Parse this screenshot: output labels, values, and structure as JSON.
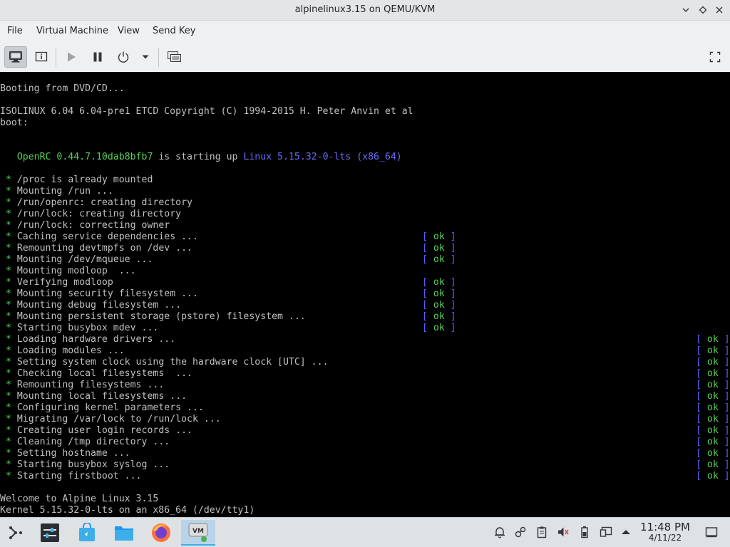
{
  "window": {
    "title": "alpinelinux3.15 on QEMU/KVM"
  },
  "menu": {
    "items": [
      "File",
      "Virtual Machine",
      "View",
      "Send Key"
    ]
  },
  "toolbar": {
    "tools": [
      "console-icon",
      "details-icon",
      "run-icon",
      "pause-icon",
      "power-icon",
      "dropdown-arrow-icon",
      "snapshots-icon",
      "fullscreen-icon"
    ]
  },
  "console": {
    "lines": [
      {
        "text": "Booting from DVD/CD..."
      },
      {
        "text": ""
      },
      {
        "text": "ISOLINUX 6.04 6.04-pre1 ETCD Copyright (C) 1994-2015 H. Peter Anvin et al"
      },
      {
        "text": "boot:"
      },
      {
        "text": ""
      },
      {
        "text": ""
      },
      {
        "openrc": true,
        "pre": "   ",
        "name": "OpenRC",
        "version": " 0.44.7.10dab8bfb7 ",
        "mid": "is starting up ",
        "linux": "Linux 5.15.32-0-lts (x86_64)"
      },
      {
        "text": ""
      },
      {
        "star": true,
        "text": "/proc is already mounted"
      },
      {
        "star": true,
        "text": "Mounting /run ..."
      },
      {
        "star": true,
        "text": "/run/openrc: creating directory"
      },
      {
        "star": true,
        "text": "/run/lock: creating directory"
      },
      {
        "star": true,
        "text": "/run/lock: correcting owner"
      },
      {
        "star": true,
        "text": "Caching service dependencies ...",
        "ok": "ok",
        "ok_at": "mid"
      },
      {
        "star": true,
        "text": "Remounting devtmpfs on /dev ...",
        "ok": "ok",
        "ok_at": "mid"
      },
      {
        "star": true,
        "text": "Mounting /dev/mqueue ...",
        "ok": "ok",
        "ok_at": "mid"
      },
      {
        "star": true,
        "text": "Mounting modloop  ..."
      },
      {
        "star": true,
        "text": "Verifying modloop",
        "ok": "ok",
        "ok_at": "mid"
      },
      {
        "star": true,
        "text": "Mounting security filesystem ...",
        "ok": "ok",
        "ok_at": "mid"
      },
      {
        "star": true,
        "text": "Mounting debug filesystem ...",
        "ok": "ok",
        "ok_at": "mid"
      },
      {
        "star": true,
        "text": "Mounting persistent storage (pstore) filesystem ...",
        "ok": "ok",
        "ok_at": "mid"
      },
      {
        "star": true,
        "text": "Starting busybox mdev ...",
        "ok": "ok",
        "ok_at": "mid"
      },
      {
        "star": true,
        "text": "Loading hardware drivers ...",
        "ok": "ok",
        "ok_at": "right"
      },
      {
        "star": true,
        "text": "Loading modules ...",
        "ok": "ok",
        "ok_at": "right"
      },
      {
        "star": true,
        "text": "Setting system clock using the hardware clock [UTC] ...",
        "ok": "ok",
        "ok_at": "right"
      },
      {
        "star": true,
        "text": "Checking local filesystems  ...",
        "ok": "ok",
        "ok_at": "right"
      },
      {
        "star": true,
        "text": "Remounting filesystems ...",
        "ok": "ok",
        "ok_at": "right"
      },
      {
        "star": true,
        "text": "Mounting local filesystems ...",
        "ok": "ok",
        "ok_at": "right"
      },
      {
        "star": true,
        "text": "Configuring kernel parameters ...",
        "ok": "ok",
        "ok_at": "right"
      },
      {
        "star": true,
        "text": "Migrating /var/lock to /run/lock ...",
        "ok": "ok",
        "ok_at": "right"
      },
      {
        "star": true,
        "text": "Creating user login records ...",
        "ok": "ok",
        "ok_at": "right"
      },
      {
        "star": true,
        "text": "Cleaning /tmp directory ...",
        "ok": "ok",
        "ok_at": "right"
      },
      {
        "star": true,
        "text": "Setting hostname ...",
        "ok": "ok",
        "ok_at": "right"
      },
      {
        "star": true,
        "text": "Starting busybox syslog ...",
        "ok": "ok",
        "ok_at": "right"
      },
      {
        "star": true,
        "text": "Starting firstboot ...",
        "ok": "ok",
        "ok_at": "right"
      },
      {
        "text": ""
      },
      {
        "text": "Welcome to Alpine Linux 3.15"
      },
      {
        "text": "Kernel 5.15.32-0-lts on an x86_64 (/dev/tty1)"
      }
    ]
  },
  "taskbar": {
    "apps": [
      "application-launcher-icon",
      "settings-app-icon",
      "discover-store-icon",
      "file-manager-icon",
      "firefox-icon",
      "virt-manager-icon"
    ],
    "tray": [
      "notifications-icon",
      "network-settings-icon",
      "clipboard-icon",
      "volume-muted-icon",
      "battery-icon",
      "display-icon",
      "show-hidden-icons-icon"
    ],
    "clock": {
      "time": "11:48 PM",
      "date": "4/11/22"
    }
  },
  "colors": {
    "ok_text": "#55d155",
    "ok_bracket": "#5b5bff",
    "linux_version": "#6a6cff",
    "taskbar_active": "#3daee9"
  }
}
